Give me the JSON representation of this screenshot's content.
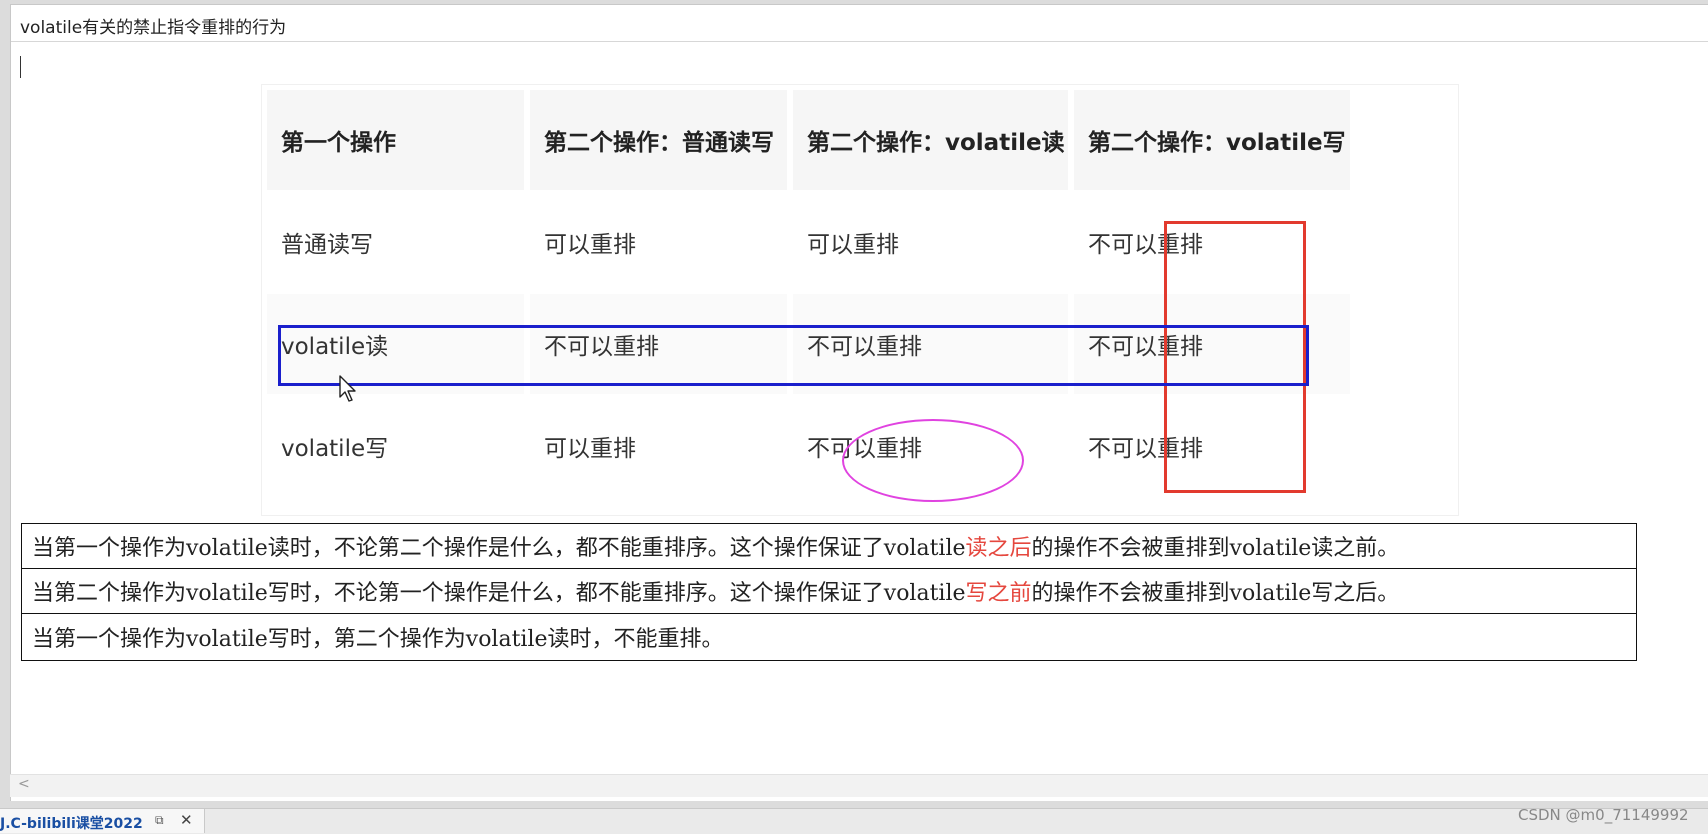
{
  "document": {
    "title": "volatile有关的禁止指令重排的行为"
  },
  "table": {
    "headers": [
      "第一个操作",
      "第二个操作：普通读写",
      "第二个操作：volatile读",
      "第二个操作：volatile写"
    ],
    "rows": [
      [
        "普通读写",
        "可以重排",
        "可以重排",
        "不可以重排"
      ],
      [
        "volatile读",
        "不可以重排",
        "不可以重排",
        "不可以重排"
      ],
      [
        "volatile写",
        "可以重排",
        "不可以重排",
        "不可以重排"
      ]
    ]
  },
  "rules": [
    {
      "pre": "当第一个操作为volatile读时，不论第二个操作是什么，都不能重排序。这个操作保证了volatile",
      "highlight": "读之后",
      "post": "的操作不会被重排到volatile读之前。"
    },
    {
      "pre": "当第二个操作为volatile写时，不论第一个操作是什么，都不能重排序。这个操作保证了volatile",
      "highlight": "写之前",
      "post": "的操作不会被重排到volatile写之后。"
    },
    {
      "pre": "当第一个操作为volatile写时，第二个操作为volatile读时，不能重排。",
      "highlight": "",
      "post": ""
    }
  ],
  "colors": {
    "red_marker": "#e23a2e",
    "blue_marker": "#1a1fcc",
    "pink_marker": "#e043e0",
    "highlight_text": "#e5473e"
  },
  "scrollbar": {
    "left_arrow": "<"
  },
  "tab": {
    "title": "J.C-bilibili课堂2022",
    "restore_icon": "⧉",
    "close_icon": "✕"
  },
  "watermark": "CSDN @m0_71149992"
}
